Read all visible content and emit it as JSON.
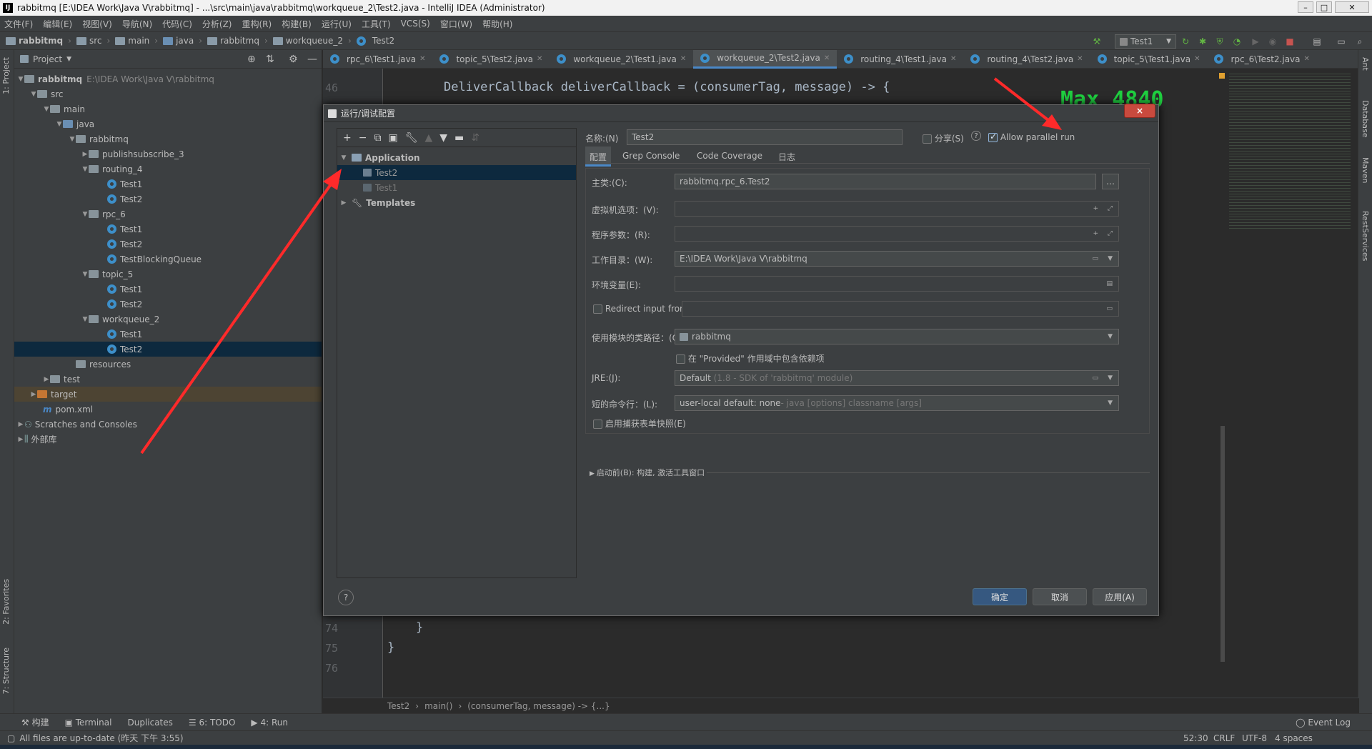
{
  "window": {
    "title": "rabbitmq [E:\\IDEA Work\\Java V\\rabbitmq] - ...\\src\\main\\java\\rabbitmq\\workqueue_2\\Test2.java - IntelliJ IDEA (Administrator)"
  },
  "menu": [
    "文件(F)",
    "编辑(E)",
    "视图(V)",
    "导航(N)",
    "代码(C)",
    "分析(Z)",
    "重构(R)",
    "构建(B)",
    "运行(U)",
    "工具(T)",
    "VCS(S)",
    "窗口(W)",
    "帮助(H)"
  ],
  "breadcrumb": [
    "rabbitmq",
    "src",
    "main",
    "java",
    "rabbitmq",
    "workqueue_2",
    "Test2"
  ],
  "run_config": "Test1",
  "project": {
    "header": "Project",
    "root_name": "rabbitmq",
    "root_path": "E:\\IDEA Work\\Java V\\rabbitmq",
    "nodes": [
      "src",
      "main",
      "java",
      "rabbitmq",
      "publishsubscribe_3",
      "routing_4",
      "Test1",
      "Test2",
      "rpc_6",
      "Test1",
      "Test2",
      "TestBlockingQueue",
      "topic_5",
      "Test1",
      "Test2",
      "workqueue_2",
      "Test1",
      "Test2",
      "resources",
      "test",
      "target",
      "pom.xml",
      "Scratches and Consoles",
      "外部库"
    ]
  },
  "tabs": [
    "rpc_6\\Test1.java",
    "topic_5\\Test2.java",
    "workqueue_2\\Test1.java",
    "workqueue_2\\Test2.java",
    "routing_4\\Test1.java",
    "routing_4\\Test2.java",
    "topic_5\\Test1.java",
    "rpc_6\\Test2.java"
  ],
  "code": {
    "line46": "46",
    "line46_text": "DeliverCallback deliverCallback = (consumerTag, message) -> {",
    "line74": "74",
    "line75": "75",
    "line76": "76",
    "brace74": "}",
    "brace75": "}",
    "overlay": "Max 4840"
  },
  "dialog": {
    "title": "运行/调试配置",
    "close": "×",
    "tree": {
      "application": "Application",
      "item1": "Test2",
      "item2": "Test1",
      "templates": "Templates"
    },
    "name_label": "名称:(N)",
    "name_value": "Test2",
    "share_label": "分享(S)",
    "parallel_label": "Allow parallel run",
    "parallel_checked": true,
    "tabs": [
      "配置",
      "Grep Console",
      "Code Coverage",
      "日志"
    ],
    "main_class_label": "主类:(C):",
    "main_class_value": "rabbitmq.rpc_6.Test2",
    "vm_label": "虚拟机选项：(V):",
    "args_label": "程序参数：(R):",
    "workdir_label": "工作目录：(W):",
    "workdir_value": "E:\\IDEA Work\\Java V\\rabbitmq",
    "env_label": "环境变量(E):",
    "redirect_label": "Redirect input from:",
    "module_label": "使用模块的类路径：(O):",
    "module_value": "rabbitmq",
    "provided_label": "在 \"Provided\" 作用域中包含依赖项",
    "jre_label": "JRE:(J):",
    "jre_value": "Default",
    "jre_hint": "(1.8 - SDK of 'rabbitmq' module)",
    "shorten_label": "短的命令行：(L):",
    "shorten_value": "user-local default: none",
    "shorten_hint": " - java [options] classname [args]",
    "snapshot_label": "启用捕获表单快照(E)",
    "before_launch": "启动前(B): 构建, 激活工具窗口",
    "ok": "确定",
    "cancel": "取消",
    "apply": "应用(A)",
    "help": "?"
  },
  "editor_breadcrumb": [
    "Test2",
    "main()",
    "(consumerTag, message) -> {...}"
  ],
  "toolwindows": [
    "构建",
    "Terminal",
    "Duplicates",
    "6: TODO",
    "4: Run"
  ],
  "event_log": "Event Log",
  "status": {
    "message": "All files are up-to-date (昨天 下午 3:55)",
    "position": "52:30",
    "line_sep": "CRLF",
    "encoding": "UTF-8",
    "indent": "4 spaces"
  },
  "side_tabs": {
    "left": [
      "1: Project",
      "2: Favorites",
      "7: Structure"
    ],
    "right": [
      "Ant",
      "Database",
      "Maven",
      "RestServices"
    ]
  },
  "colors": {
    "accent": "#4a88c7",
    "selection": "#0d293e",
    "arrow": "#ff2a2a",
    "overlay": "#1fd040"
  }
}
